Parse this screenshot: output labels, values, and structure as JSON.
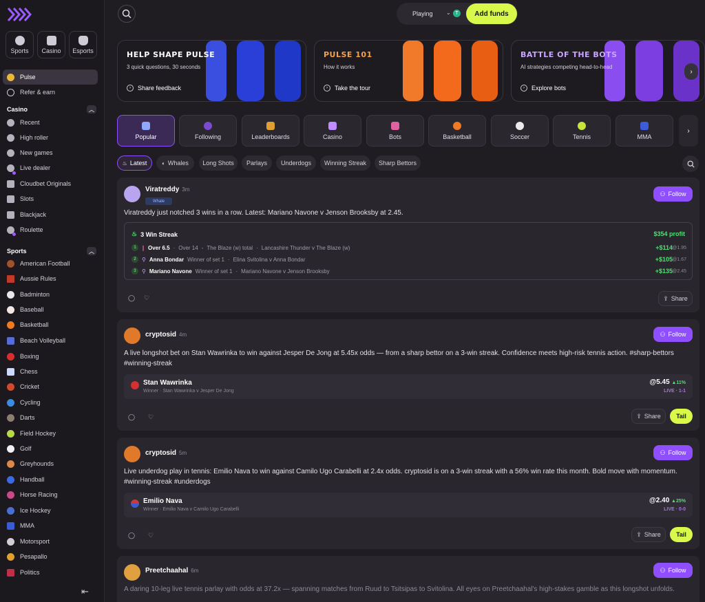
{
  "top_categories": [
    {
      "label": "Sports",
      "icon": "soccer-ball-icon"
    },
    {
      "label": "Casino",
      "icon": "dice-icon"
    },
    {
      "label": "Esports",
      "icon": "gamepad-icon"
    }
  ],
  "nav_main": [
    {
      "label": "Pulse",
      "icon": "pulse-icon"
    },
    {
      "label": "Refer & earn",
      "icon": "users-icon"
    }
  ],
  "casino_section": {
    "title": "Casino",
    "items": [
      "Recent",
      "High roller",
      "New games",
      "Live dealer",
      "Cloudbet Originals",
      "Slots",
      "Blackjack",
      "Roulette"
    ]
  },
  "sports_section": {
    "title": "Sports",
    "items": [
      "American Football",
      "Aussie Rules",
      "Badminton",
      "Baseball",
      "Basketball",
      "Beach Volleyball",
      "Boxing",
      "Chess",
      "Cricket",
      "Cycling",
      "Darts",
      "Field Hockey",
      "Golf",
      "Greyhounds",
      "Handball",
      "Horse Racing",
      "Ice Hockey",
      "MMA",
      "Motorsport",
      "Pesapallo",
      "Politics"
    ]
  },
  "topbar": {
    "playing_label": "Playing",
    "token_symbol": "T",
    "add_funds_label": "Add funds"
  },
  "promos": [
    {
      "title": "HELP SHAPE PULSE",
      "subtitle": "3 quick questions, 30 seconds",
      "link": "Share feedback",
      "color": "#2a3fd8"
    },
    {
      "title": "PULSE 101",
      "subtitle": "How it works",
      "link": "Take the tour",
      "color": "#f36a1c"
    },
    {
      "title": "BATTLE OF THE BOTS",
      "subtitle": "AI strategies competing head-to-head",
      "link": "Explore bots",
      "color": "#7c3ee0"
    }
  ],
  "feed_tabs": [
    "Popular",
    "Following",
    "Leaderboards",
    "Casino",
    "Bots",
    "Basketball",
    "Soccer",
    "Tennis",
    "MMA"
  ],
  "filter_chips": [
    "Latest",
    "Whales",
    "Long Shots",
    "Parlays",
    "Underdogs",
    "Winning Streak",
    "Sharp Bettors"
  ],
  "posts": [
    {
      "user": "Viratreddy",
      "time": "3m",
      "badge": "Whale",
      "text": "Viratreddy just notched 3 wins in a row. Latest: Mariano Navone v Jenson Brooksby at 2.45.",
      "follow_label": "Follow",
      "streak": {
        "title": "3 Win Streak",
        "profit": "$354 profit",
        "legs": [
          {
            "num": "1",
            "name": "Over 6.5",
            "market": "Over 14",
            "event": "The Blaze (w) total",
            "match": "Lancashire Thunder v The Blaze (w)",
            "win": "+$114",
            "odds": "@1.95"
          },
          {
            "num": "2",
            "name": "Anna Bondar",
            "market": "Winner of set 1",
            "event": "",
            "match": "Elina Svitolina v Anna Bondar",
            "win": "+$105",
            "odds": "@1.67"
          },
          {
            "num": "3",
            "name": "Mariano Navone",
            "market": "Winner of set 1",
            "event": "",
            "match": "Mariano Navone v Jenson Brooksby",
            "win": "+$135",
            "odds": "@2.45"
          }
        ]
      },
      "share_label": "Share"
    },
    {
      "user": "cryptosid",
      "time": "4m",
      "text": "A live longshot bet on Stan Wawrinka to win against Jesper De Jong at 5.45x odds — from a sharp bettor on a 3-win streak. Confidence meets high-risk tennis action. #sharp-bettors #winning-streak",
      "follow_label": "Follow",
      "bet": {
        "name": "Stan Wawrinka",
        "sub": "Winner · Stan Wawrinka v Jesper De Jong",
        "odds": "@5.45",
        "change": "▲11%",
        "live": "LIVE · 1-1"
      },
      "share_label": "Share",
      "tail_label": "Tail"
    },
    {
      "user": "cryptosid",
      "time": "5m",
      "text": "Live underdog play in tennis: Emilio Nava to win against Camilo Ugo Carabelli at 2.4x odds. cryptosid is on a 3-win streak with a 56% win rate this month. Bold move with momentum. #winning-streak #underdogs",
      "follow_label": "Follow",
      "bet": {
        "name": "Emilio Nava",
        "sub": "Winner · Emilio Nava v Camilo Ugo Carabelli",
        "odds": "@2.40",
        "change": "▲25%",
        "live": "LIVE · 0-0"
      },
      "share_label": "Share",
      "tail_label": "Tail"
    },
    {
      "user": "Preetchaahal",
      "time": "6m",
      "text": "A daring 10-leg live tennis parlay with odds at 37.2x — spanning matches from Ruud to Tsitsipas to Svitolina. All eyes on Preetchaahal's high-stakes gamble as this longshot unfolds.",
      "follow_label": "Follow"
    }
  ],
  "colors": {
    "accent": "#8f4fff",
    "cta": "#d8f84a",
    "win": "#4de073"
  }
}
